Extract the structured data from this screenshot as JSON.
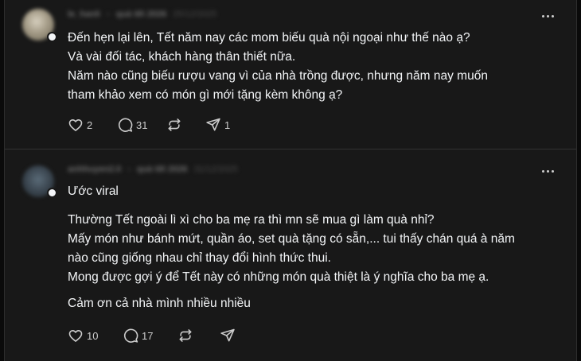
{
  "posts": [
    {
      "username": "le_hanli",
      "topic": "quà tết 2026",
      "date": "25/12/2025",
      "lines": [
        "Đến hẹn lại lên, Tết năm nay các mom biếu quà nội ngoại như thế nào ạ?",
        "Và vài đối tác, khách hàng thân thiết nữa.",
        "Năm nào cũng biếu rượu vang vì của nhà trồng được, nhưng năm nay muốn",
        "tham khảo xem có món gì mới tặng kèm không ạ?"
      ],
      "likes": "2",
      "replies": "31",
      "reposts": "",
      "shares": "1"
    },
    {
      "username": "anhhuyen2.0",
      "topic": "quà tết 2026",
      "date": "31/12/2025",
      "heading": "Ước viral",
      "lines": [
        "Thường Tết ngoài lì xì cho ba mẹ ra thì mn sẽ mua gì làm quà nhỉ?",
        "Mấy món như bánh mứt, quần áo, set quà tặng có sẵn,... tui thấy chán quá à năm",
        "nào cũng giống nhau chỉ thay đổi hình thức thui.",
        "Mong được gợi ý để Tết này có những món quà thiệt là ý nghĩa cho ba mẹ ạ."
      ],
      "closing": "Cảm ơn cả nhà mình nhiều nhiều",
      "likes": "10",
      "replies": "17",
      "reposts": "",
      "shares": ""
    }
  ],
  "icons": {
    "like": "heart-icon",
    "reply": "comment-icon",
    "repost": "repost-icon",
    "share": "share-icon",
    "more": "more-icon"
  }
}
